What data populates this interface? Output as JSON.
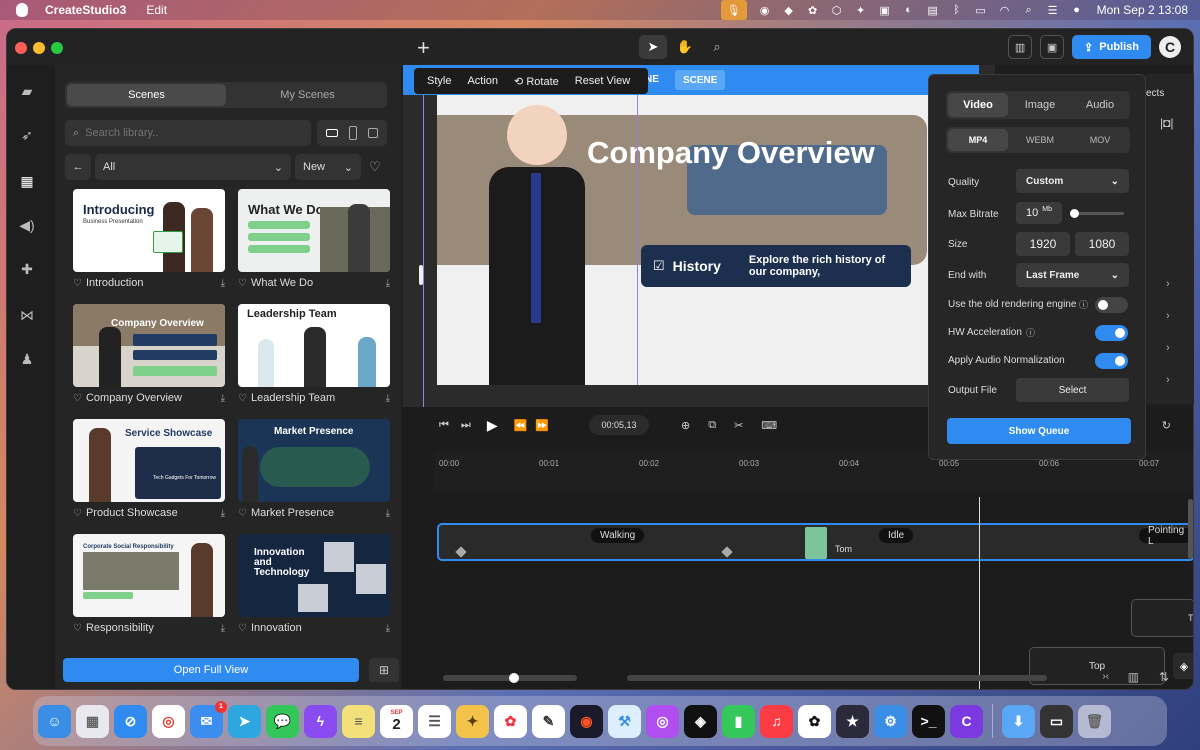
{
  "menubar": {
    "app_name": "CreateStudio3",
    "edit_menu": "Edit",
    "datetime": "Mon Sep 2  13:08"
  },
  "toolbar": {
    "publish_label": "Publish"
  },
  "library": {
    "tab_scenes": "Scenes",
    "tab_my_scenes": "My Scenes",
    "search_placeholder": "Search library..",
    "category_filter": "All",
    "sort_filter": "New",
    "open_full_view": "Open Full View",
    "cards": [
      {
        "label": "Introduction",
        "thumb_title": "Introducing",
        "thumb_sub": "Business Presentation"
      },
      {
        "label": "What We Do",
        "thumb_title": "What We Do"
      },
      {
        "label": "Company Overview",
        "thumb_title": "Company Overview"
      },
      {
        "label": "Leadership Team",
        "thumb_title": "Leadership Team"
      },
      {
        "label": "Product Showcase",
        "thumb_title": "Service Showcase",
        "thumb_sub": "Tech Gadgets For Tomorrow"
      },
      {
        "label": "Market Presence",
        "thumb_title": "Market Presence"
      },
      {
        "label": "Responsibility",
        "thumb_title": "Corporate Social Responsibility"
      },
      {
        "label": "Innovation",
        "thumb_title": "Innovation and Technology"
      }
    ]
  },
  "canvas": {
    "context_menu": {
      "style": "Style",
      "action": "Action",
      "rotate": "Rotate",
      "reset_view": "Reset View"
    },
    "scene_badge": "SCENE",
    "scene_badge_partial": "NE",
    "slide_title": "Company Overview",
    "banner_label": "History",
    "banner_text": "Explore the rich history of our company,"
  },
  "export": {
    "tabs": [
      "Video",
      "Image",
      "Audio"
    ],
    "formats": [
      "MP4",
      "WEBM",
      "MOV"
    ],
    "quality_label": "Quality",
    "quality_value": "Custom",
    "bitrate_label": "Max Bitrate",
    "bitrate_value": "10",
    "bitrate_unit": "Mb",
    "bitrate_level": 0.08,
    "size_label": "Size",
    "size_width": "1920",
    "size_height": "1080",
    "end_with_label": "End with",
    "end_with_value": "Last Frame",
    "old_engine_label": "Use the old rendering engine",
    "old_engine_on": false,
    "hw_accel_label": "HW Acceleration",
    "hw_accel_on": true,
    "audio_norm_label": "Apply Audio Normalization",
    "audio_norm_on": true,
    "output_file_label": "Output File",
    "output_select": "Select",
    "show_queue": "Show Queue"
  },
  "right_panel": {
    "effects_partial": "ects"
  },
  "timeline": {
    "timecode": "00:05,13",
    "ticks": [
      "00:00",
      "00:01",
      "00:02",
      "00:03",
      "00:04",
      "00:05",
      "00:06",
      "00:07"
    ],
    "clips": [
      "Walking",
      "Idle",
      "Pointing L"
    ],
    "character_label": "Tom",
    "track_top_label": "Top",
    "track_partial": "Te"
  },
  "dock": {
    "calendar_month": "SEP",
    "calendar_day": "2",
    "mail_badge": "1"
  }
}
